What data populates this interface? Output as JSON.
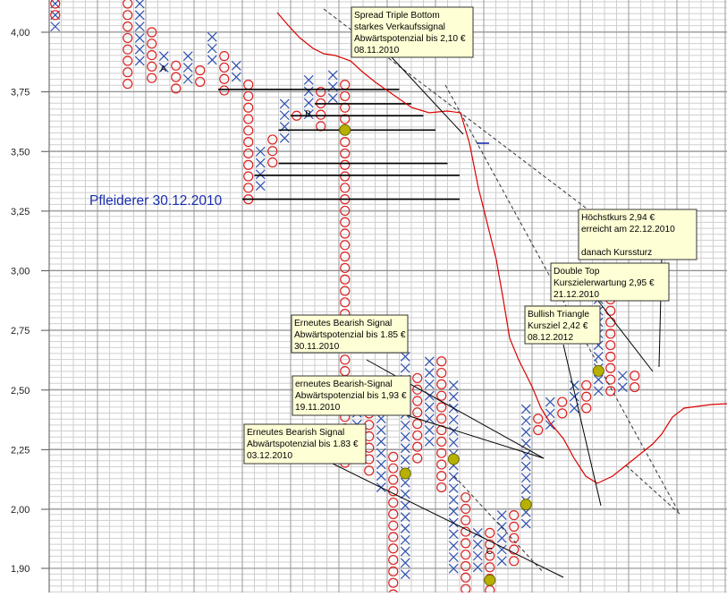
{
  "chart_data": {
    "type": "point-and-figure",
    "title": "Pfleiderer   30.12.2010",
    "y_ticks": [
      {
        "value": 4.0,
        "label": "4,00"
      },
      {
        "value": 3.75,
        "label": "3,75"
      },
      {
        "value": 3.5,
        "label": "3,50"
      },
      {
        "value": 3.25,
        "label": "3,25"
      },
      {
        "value": 3.0,
        "label": "3,00"
      },
      {
        "value": 2.75,
        "label": "2,75"
      },
      {
        "value": 2.5,
        "label": "2,50"
      },
      {
        "value": 2.25,
        "label": "2,25"
      },
      {
        "value": 2.0,
        "label": "2,00"
      },
      {
        "value": 1.9,
        "label": "1,90"
      }
    ],
    "columns": [
      {
        "col": 0,
        "type": "X",
        "from": 3.99,
        "to": 4.12
      },
      {
        "col": 0,
        "type": "O",
        "from": 4.03,
        "to": 4.12
      },
      {
        "col": 6,
        "type": "O",
        "from": 3.78,
        "to": 4.12
      },
      {
        "col": 7,
        "type": "X",
        "from": 3.84,
        "to": 4.12
      },
      {
        "col": 8,
        "type": "O",
        "from": 3.78,
        "to": 4.0
      },
      {
        "col": 9,
        "type": "X",
        "from": 3.84,
        "to": 3.9
      },
      {
        "col": 10,
        "type": "O",
        "from": 3.75,
        "to": 3.86
      },
      {
        "col": 11,
        "type": "X",
        "from": 3.78,
        "to": 3.9
      },
      {
        "col": 12,
        "type": "O",
        "from": 3.78,
        "to": 3.84
      },
      {
        "col": 13,
        "type": "X",
        "from": 3.84,
        "to": 3.98
      },
      {
        "col": 14,
        "type": "O",
        "from": 3.72,
        "to": 3.9
      },
      {
        "col": 15,
        "type": "X",
        "from": 3.78,
        "to": 3.86
      },
      {
        "col": 16,
        "type": "O",
        "from": 3.3,
        "to": 3.78
      },
      {
        "col": 17,
        "type": "X",
        "from": 3.35,
        "to": 3.5
      },
      {
        "col": 18,
        "type": "O",
        "from": 3.45,
        "to": 3.55
      },
      {
        "col": 19,
        "type": "X",
        "from": 3.55,
        "to": 3.7
      },
      {
        "col": 20,
        "type": "O",
        "from": 3.62,
        "to": 3.65
      },
      {
        "col": 21,
        "type": "X",
        "from": 3.65,
        "to": 3.8
      },
      {
        "col": 22,
        "type": "O",
        "from": 3.6,
        "to": 3.75
      },
      {
        "col": 23,
        "type": "X",
        "from": 3.7,
        "to": 3.82
      },
      {
        "col": 24,
        "type": "O",
        "from": 2.18,
        "to": 3.78
      },
      {
        "col": 25,
        "type": "X",
        "from": 2.2,
        "to": 2.5
      },
      {
        "col": 26,
        "type": "O",
        "from": 2.12,
        "to": 2.45
      },
      {
        "col": 27,
        "type": "X",
        "from": 2.06,
        "to": 2.38
      },
      {
        "col": 28,
        "type": "O",
        "from": 1.84,
        "to": 2.22
      },
      {
        "col": 29,
        "type": "X",
        "from": 1.88,
        "to": 2.64
      },
      {
        "col": 30,
        "type": "O",
        "from": 2.2,
        "to": 2.55
      },
      {
        "col": 31,
        "type": "X",
        "from": 2.28,
        "to": 2.62
      },
      {
        "col": 32,
        "type": "O",
        "from": 2.06,
        "to": 2.62
      },
      {
        "col": 33,
        "type": "X",
        "from": 1.9,
        "to": 2.52
      },
      {
        "col": 34,
        "type": "O",
        "from": 1.84,
        "to": 2.05
      },
      {
        "col": 35,
        "type": "X",
        "from": 1.9,
        "to": 1.96
      },
      {
        "col": 36,
        "type": "O",
        "from": 1.86,
        "to": 1.96
      },
      {
        "col": 37,
        "type": "X",
        "from": 1.9,
        "to": 1.99
      },
      {
        "col": 38,
        "type": "O",
        "from": 1.9,
        "to": 1.99
      },
      {
        "col": 39,
        "type": "X",
        "from": 1.96,
        "to": 2.42
      },
      {
        "col": 40,
        "type": "O",
        "from": 2.3,
        "to": 2.38
      },
      {
        "col": 41,
        "type": "X",
        "from": 2.34,
        "to": 2.45
      },
      {
        "col": 42,
        "type": "O",
        "from": 2.38,
        "to": 2.45
      },
      {
        "col": 43,
        "type": "X",
        "from": 2.42,
        "to": 2.52
      },
      {
        "col": 44,
        "type": "O",
        "from": 2.42,
        "to": 2.52
      },
      {
        "col": 45,
        "type": "X",
        "from": 2.48,
        "to": 2.88
      },
      {
        "col": 46,
        "type": "O",
        "from": 2.45,
        "to": 2.88
      },
      {
        "col": 47,
        "type": "X",
        "from": 2.5,
        "to": 2.56
      },
      {
        "col": 48,
        "type": "O",
        "from": 2.48,
        "to": 2.56
      }
    ],
    "signal_markers": [
      {
        "col": 24,
        "value": 3.59
      },
      {
        "col": 29,
        "value": 2.15
      },
      {
        "col": 33,
        "value": 2.21
      },
      {
        "col": 36,
        "value": 1.88
      },
      {
        "col": 39,
        "value": 2.02
      },
      {
        "col": 45,
        "value": 2.58
      }
    ],
    "support_lines": [
      {
        "value": 3.76,
        "from_col": 14,
        "to_col": 29
      },
      {
        "value": 3.7,
        "from_col": 22,
        "to_col": 30
      },
      {
        "value": 3.65,
        "from_col": 20,
        "to_col": 31
      },
      {
        "value": 3.59,
        "from_col": 19,
        "to_col": 32
      },
      {
        "value": 3.45,
        "from_col": 19,
        "to_col": 33
      },
      {
        "value": 3.4,
        "from_col": 17,
        "to_col": 34
      },
      {
        "value": 3.3,
        "from_col": 16,
        "to_col": 34
      }
    ],
    "point_labels": [
      {
        "text": "A",
        "col": 9,
        "value": 3.85
      },
      {
        "text": "B",
        "col": 21,
        "value": 3.66
      },
      {
        "text": "C",
        "col": 36,
        "value": 1.93
      }
    ],
    "annotations": [
      {
        "lines": [
          "Spread Triple Bottom",
          "starkes Verkaufssignal",
          "Abwärtspotenzial bis 2,10 €",
          "08.11.2010"
        ]
      },
      {
        "lines": [
          "Höchstkurs 2,94 €",
          "erreicht am 22.12.2010",
          "",
          "danach Kurssturz"
        ]
      },
      {
        "lines": [
          "Double Top",
          "Kurszielerwartung 2,95 €",
          "21.12.2010"
        ]
      },
      {
        "lines": [
          "Bullish Triangle",
          "Kursziel  2,42 €",
          "08.12.2012"
        ]
      },
      {
        "lines": [
          "Erneutes Bearish Signal",
          "Abwärtspotenzial bis 1.85 €",
          "30.11.2010"
        ]
      },
      {
        "lines": [
          "erneutes Bearish-Signal",
          "Abwärtspotenzial bis 1,93 €",
          "19.11.2010"
        ]
      },
      {
        "lines": [
          "Erneutes Bearish Signal",
          "Abwärtspotenzial bis 1.83 €",
          "03.12.2010"
        ]
      }
    ],
    "moving_average_color": "#dd0000",
    "x_color": "#3050b0",
    "o_color": "#dd2020",
    "marker_color": "#b8b000",
    "title_color": "#1a2fb0",
    "grid": true
  }
}
